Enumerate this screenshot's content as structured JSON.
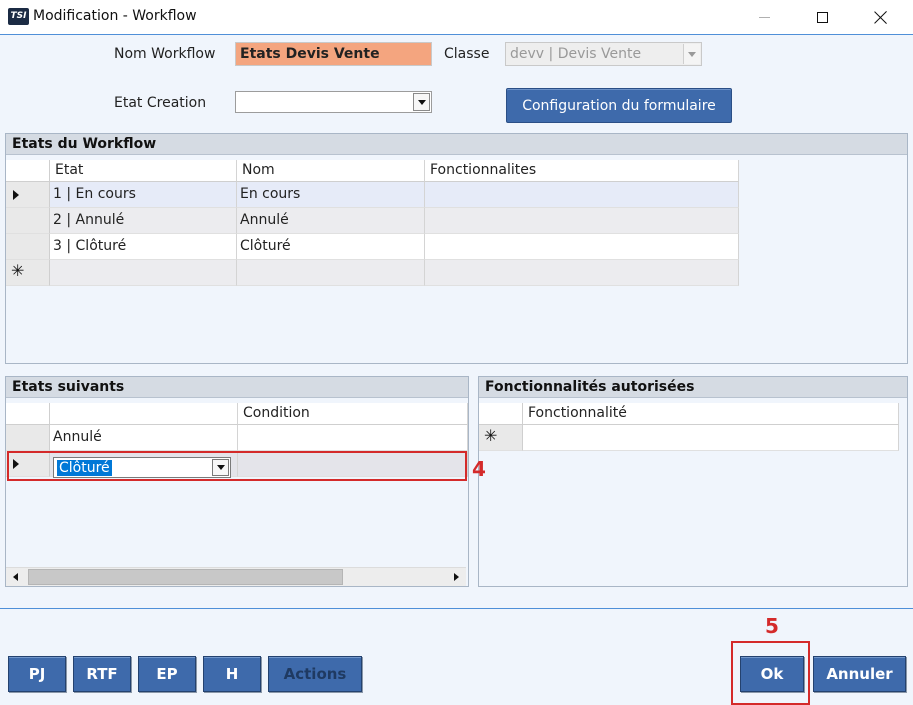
{
  "window": {
    "logo": "TSI",
    "title": "Modification - Workflow"
  },
  "form": {
    "nom_workflow_label": "Nom Workflow",
    "nom_workflow_value": "Etats Devis Vente",
    "classe_label": "Classe",
    "classe_value": "devv | Devis Vente",
    "etat_creation_label": "Etat Creation",
    "etat_creation_value": "",
    "config_button": "Configuration du formulaire"
  },
  "etats_workflow": {
    "title": "Etats du Workflow",
    "columns": [
      "Etat",
      "Nom",
      "Fonctionnalites"
    ],
    "rows": [
      {
        "etat": "1 | En cours",
        "nom": "En cours",
        "fonctionnalites": ""
      },
      {
        "etat": "2 | Annulé",
        "nom": "Annulé",
        "fonctionnalites": ""
      },
      {
        "etat": "3 | Clôturé",
        "nom": "Clôturé",
        "fonctionnalites": ""
      }
    ]
  },
  "etats_suivants": {
    "title": "Etats suivants",
    "columns": [
      "",
      "Condition"
    ],
    "rows": [
      {
        "etat": "Annulé",
        "condition": ""
      }
    ],
    "editing_value": "Clôturé"
  },
  "fonctionnalites_autorisees": {
    "title": "Fonctionnalités autorisées",
    "columns": [
      "Fonctionnalité"
    ]
  },
  "buttons": {
    "pj": "PJ",
    "rtf": "RTF",
    "ep": "EP",
    "h": "H",
    "actions": "Actions",
    "ok": "Ok",
    "annuler": "Annuler"
  },
  "annotations": {
    "step4": "4",
    "step5": "5"
  },
  "colors": {
    "accent": "#3e6aab",
    "highlight_field": "#f4a57f",
    "annotation": "#d42a2a",
    "selection": "#0078d7"
  }
}
